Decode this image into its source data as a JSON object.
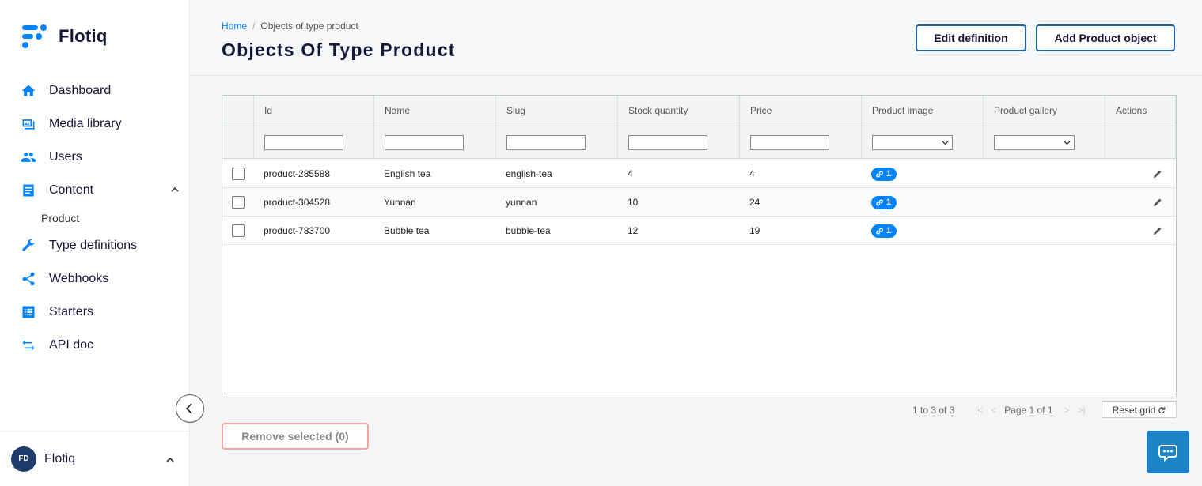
{
  "sidebar": {
    "brand": "Flotiq",
    "items": [
      {
        "label": "Dashboard",
        "icon": "home-icon"
      },
      {
        "label": "Media library",
        "icon": "media-icon"
      },
      {
        "label": "Users",
        "icon": "users-icon"
      },
      {
        "label": "Content",
        "icon": "content-icon",
        "expanded": true
      },
      {
        "label": "Type definitions",
        "icon": "wrench-icon"
      },
      {
        "label": "Webhooks",
        "icon": "share-icon"
      },
      {
        "label": "Starters",
        "icon": "list-icon"
      },
      {
        "label": "API doc",
        "icon": "swap-icon"
      }
    ],
    "content_sub": [
      "Product"
    ],
    "footer": {
      "initials": "FD",
      "name": "Flotiq"
    }
  },
  "header": {
    "breadcrumb": {
      "home": "Home",
      "current": "Objects of type product"
    },
    "title": "Objects Of Type Product",
    "edit_label": "Edit definition",
    "add_label": "Add Product object"
  },
  "grid": {
    "columns": [
      "Id",
      "Name",
      "Slug",
      "Stock quantity",
      "Price",
      "Product image",
      "Product gallery",
      "Actions"
    ],
    "rows": [
      {
        "id": "product-285588",
        "name": "English tea",
        "slug": "english-tea",
        "stock": "4",
        "price": "4",
        "image_count": "1"
      },
      {
        "id": "product-304528",
        "name": "Yunnan",
        "slug": "yunnan",
        "stock": "10",
        "price": "24",
        "image_count": "1"
      },
      {
        "id": "product-783700",
        "name": "Bubble tea",
        "slug": "bubble-tea",
        "stock": "12",
        "price": "19",
        "image_count": "1"
      }
    ]
  },
  "pagination": {
    "summary": "1 to 3 of 3",
    "page_text": "Page 1 of 1",
    "reset_label": "Reset grid"
  },
  "actions": {
    "remove_label": "Remove selected (0)"
  },
  "colors": {
    "accent": "#0083fc",
    "title": "#16163a",
    "button_border": "#1d5fa8",
    "danger_border": "#f5a4a4",
    "chat": "#1e84c8"
  }
}
